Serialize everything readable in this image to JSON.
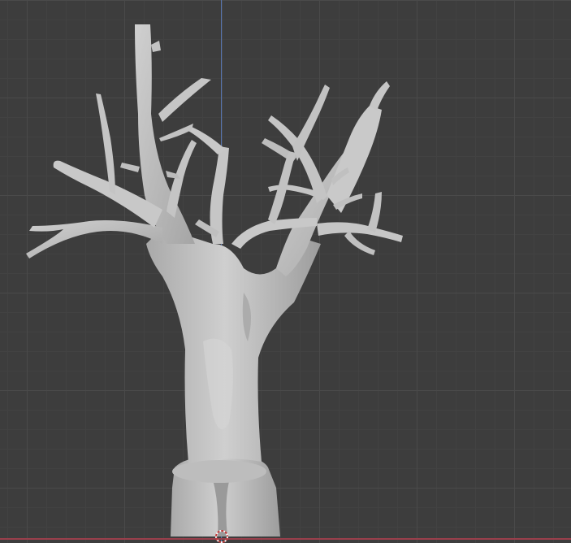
{
  "viewport": {
    "view": "3D Viewport",
    "background_color": "#3d3d3d",
    "grid_color": "#4a4a4a",
    "axis_z_color": "#5a7fc4",
    "axis_x_color": "#9a3f4c"
  },
  "object": {
    "type": "mesh",
    "description_icon": "tree-mesh",
    "color": "#c9c9c9"
  },
  "cursor": {
    "icon": "3d-cursor-icon"
  }
}
